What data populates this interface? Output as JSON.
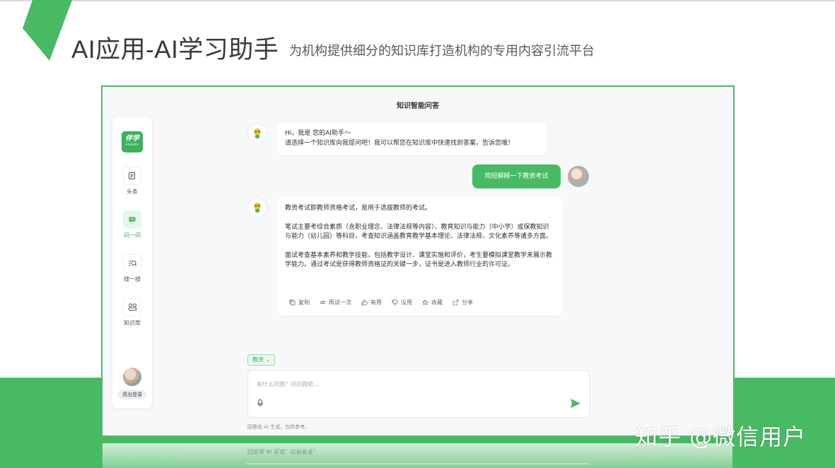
{
  "slide": {
    "title": "AI应用-AI学习助手",
    "subtitle": "为机构提供细分的知识库打造机构的专用内容引流平台",
    "watermark": "知乎 @微信用户",
    "accent_color": "#49ba64"
  },
  "app": {
    "title": "知识智能问答",
    "logo": {
      "main": "伴学",
      "sub": "EduSaha"
    },
    "sidebar": {
      "items": [
        {
          "label": "头条",
          "icon": "document-icon"
        },
        {
          "label": "问一问",
          "icon": "chat-bubble-icon",
          "active": true
        },
        {
          "label": "搜一搜",
          "icon": "search-list-icon"
        },
        {
          "label": "知识库",
          "icon": "knowledge-base-icon"
        }
      ],
      "logout_label": "退出登录"
    },
    "chat": {
      "greeting": {
        "line1": "Hi，我是 您的AI助手～",
        "line2": "请选择一个知识库向我提问吧！我可以帮您在知识库中快速找到答案，告诉您哦！"
      },
      "user_message": "简短解释一下教资考试",
      "answer": {
        "p1": "教资考试即教师资格考试，是用于选拔教师的考试。",
        "p2": "笔试主要考综合素质（含职业理念、法律法规等内容）、教育知识与能力（中小学）或保教知识与能力（幼儿园）等科目，考查知识涵盖教育教学基本理论、法律法规、文化素养等诸多方面。",
        "p3": "面试考查基本素养和教学技能，包括教学设计、课堂实施和评价，考生要模拟课堂教学来展示教学能力。通过考试是获得教师资格证的关键一步，证书是进入教师行业的许可证。"
      },
      "actions": [
        "复制",
        "再试一次",
        "有用",
        "没用",
        "收藏",
        "分享"
      ]
    },
    "input": {
      "knowledge_tag": "教资",
      "placeholder": "有什么问题？问问我吧…",
      "disclaimer": "回答由 AI 生成，仅供参考。"
    }
  }
}
